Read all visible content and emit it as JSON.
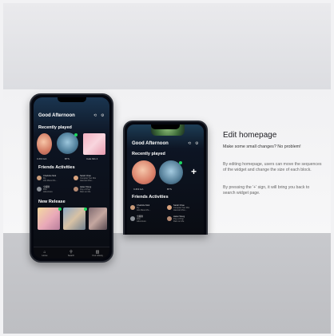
{
  "phone1": {
    "greeting": "Good Afternoon",
    "recently_played": "Recently played",
    "recent_items": [
      "CJK3 HA",
      "BTS",
      "Cafe Mix 4"
    ],
    "friends_activities": "Friends Activities",
    "friends": [
      {
        "name": "Charlotte Mok",
        "sub": "Fly",
        "track": "Hot Mess Mo..."
      },
      {
        "name": "Sarah Chau",
        "sub": "Comptez Sur Moi",
        "track": "Harvest Moo..."
      },
      {
        "name": "全藤鍋",
        "sub": "Film",
        "track": "Adventure"
      },
      {
        "name": "Helen Wong",
        "sub": "Pop of Pop",
        "track": "Rain on Me"
      }
    ],
    "new_release": "New Release",
    "tabs": [
      "Home",
      "Search",
      "Your Library"
    ]
  },
  "phone2": {
    "greeting": "Good Afternoon",
    "recently_played": "Recently played",
    "recent_items": [
      "CJK3 HA",
      "BTS"
    ],
    "plus": "+",
    "friends_activities": "Friends Activities"
  },
  "panel": {
    "title": "Edit homepage",
    "subtitle": "Make some small changes? No problem!",
    "para1": "By editing homepage, users can move the sequences of the widget and change the size of each block.",
    "para2": "By pressing the '+' sign, it will bring you back to search widget page."
  }
}
